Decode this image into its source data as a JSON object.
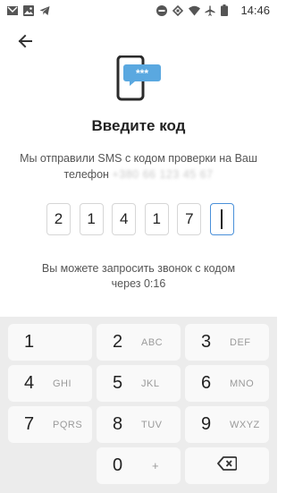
{
  "status_bar": {
    "time": "14:46",
    "left_icons": [
      "gmail-icon",
      "image-icon",
      "telegram-icon"
    ],
    "right_icons": [
      "dnd-icon",
      "vibrate-icon",
      "wifi-icon",
      "airplane-icon",
      "battery-icon"
    ]
  },
  "header": {
    "back_icon": "arrow-left-icon"
  },
  "title": "Введите код",
  "description": {
    "text": "Мы отправили SMS с кодом проверки на Ваш телефон",
    "phone_masked": "+380 66 123 45 67"
  },
  "code": {
    "digits": [
      "2",
      "1",
      "4",
      "1",
      "7",
      ""
    ],
    "active_index": 5
  },
  "call_info": {
    "line1": "Вы можете запросить звонок с кодом",
    "line2": "через 0:16"
  },
  "keypad": {
    "keys": [
      {
        "num": "1",
        "letters": ""
      },
      {
        "num": "2",
        "letters": "ABC"
      },
      {
        "num": "3",
        "letters": "DEF"
      },
      {
        "num": "4",
        "letters": "GHI"
      },
      {
        "num": "5",
        "letters": "JKL"
      },
      {
        "num": "6",
        "letters": "MNO"
      },
      {
        "num": "7",
        "letters": "PQRS"
      },
      {
        "num": "8",
        "letters": "TUV"
      },
      {
        "num": "9",
        "letters": "WXYZ"
      },
      {
        "num": "0",
        "letters": "+"
      }
    ],
    "backspace_icon": "backspace-icon"
  },
  "colors": {
    "accent": "#4a90d9",
    "keypad_bg": "#ececec",
    "key_bg": "#f9f9f9"
  }
}
